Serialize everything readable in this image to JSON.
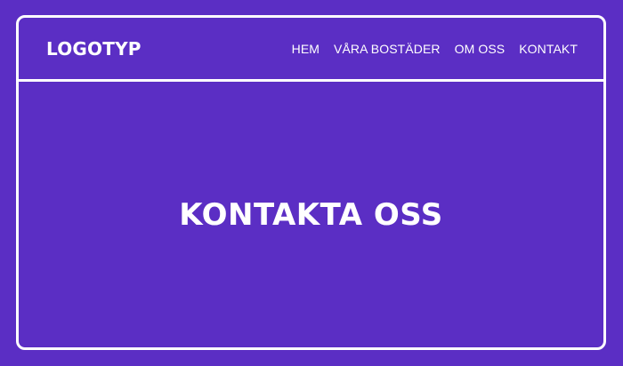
{
  "header": {
    "logo_text": "LOGOTYP",
    "nav": [
      {
        "label": "HEM"
      },
      {
        "label": "VÅRA BOSTÄDER"
      },
      {
        "label": "OM OSS"
      },
      {
        "label": "KONTAKT"
      }
    ]
  },
  "hero": {
    "title": "KONTAKTA OSS"
  },
  "colors": {
    "background": "#5b2ec4",
    "foreground": "#ffffff"
  }
}
